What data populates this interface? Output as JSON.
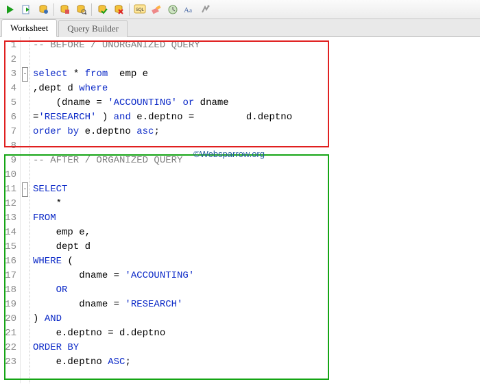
{
  "toolbar": {
    "icons": [
      {
        "name": "run-icon"
      },
      {
        "name": "run-script-icon"
      },
      {
        "name": "explain-plan-icon"
      },
      {
        "name": "sep"
      },
      {
        "name": "autotrace-icon"
      },
      {
        "name": "sql-tuning-icon"
      },
      {
        "name": "sep"
      },
      {
        "name": "commit-icon"
      },
      {
        "name": "rollback-icon"
      },
      {
        "name": "sep"
      },
      {
        "name": "sql-icon"
      },
      {
        "name": "clear-icon"
      },
      {
        "name": "history-icon"
      },
      {
        "name": "case-icon"
      },
      {
        "name": "format-icon"
      }
    ]
  },
  "tabs": {
    "worksheet": "Worksheet",
    "query_builder": "Query Builder"
  },
  "watermark": "©Websparrow.org",
  "code": {
    "lines": [
      {
        "n": 1,
        "html": "<span class='comment'>-- BEFORE / UNORGANIZED QUERY</span>"
      },
      {
        "n": 2,
        "html": ""
      },
      {
        "n": 3,
        "html": "<span class='kw'>select</span> * <span class='kw'>from</span>  emp e",
        "fold": true
      },
      {
        "n": 4,
        "html": ",dept d <span class='kw'>where</span>"
      },
      {
        "n": 5,
        "html": "    (dname = <span class='str'>'ACCOUNTING'</span> <span class='kw'>or</span> dname"
      },
      {
        "n": 6,
        "html": "=<span class='str'>'RESEARCH'</span> ) <span class='kw'>and</span> e.deptno =         d.deptno"
      },
      {
        "n": 7,
        "html": "<span class='kw'>order by</span> e.deptno <span class='kw'>asc</span>;"
      },
      {
        "n": 8,
        "html": ""
      },
      {
        "n": 9,
        "html": "<span class='comment'>-- AFTER / ORGANIZED QUERY</span>"
      },
      {
        "n": 10,
        "html": ""
      },
      {
        "n": 11,
        "html": "<span class='kw'>SELECT</span>",
        "fold": true
      },
      {
        "n": 12,
        "html": "    *"
      },
      {
        "n": 13,
        "html": "<span class='kw'>FROM</span>"
      },
      {
        "n": 14,
        "html": "    emp e,"
      },
      {
        "n": 15,
        "html": "    dept d"
      },
      {
        "n": 16,
        "html": "<span class='kw'>WHERE</span> ("
      },
      {
        "n": 17,
        "html": "        dname = <span class='str'>'ACCOUNTING'</span>"
      },
      {
        "n": 18,
        "html": "    <span class='kw'>OR</span>"
      },
      {
        "n": 19,
        "html": "        dname = <span class='str'>'RESEARCH'</span>"
      },
      {
        "n": 20,
        "html": ") <span class='kw'>AND</span>"
      },
      {
        "n": 21,
        "html": "    e.deptno = d.deptno"
      },
      {
        "n": 22,
        "html": "<span class='kw'>ORDER BY</span>"
      },
      {
        "n": 23,
        "html": "    e.deptno <span class='kw'>ASC</span>;"
      }
    ]
  }
}
